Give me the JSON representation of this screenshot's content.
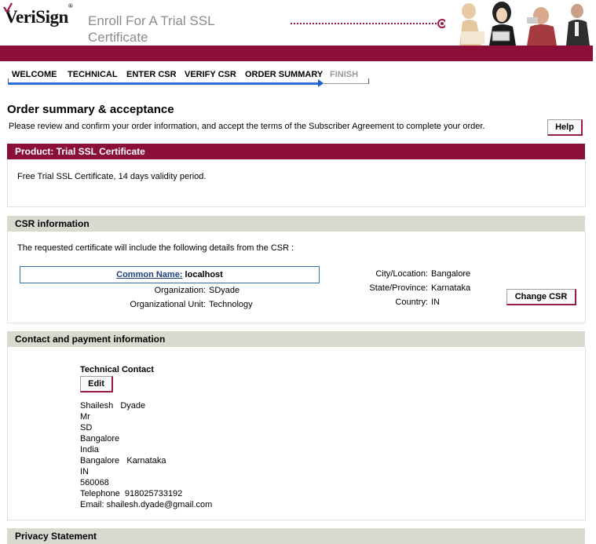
{
  "header": {
    "logo_text": "VeriSign",
    "logo_mark": "®",
    "title_line1": "Enroll For A Trial SSL",
    "title_line2": "Certificate"
  },
  "steps": [
    {
      "label": "WELCOME",
      "state": "done"
    },
    {
      "label": "TECHNICAL",
      "state": "done"
    },
    {
      "label": "ENTER CSR",
      "state": "done"
    },
    {
      "label": "VERIFY CSR",
      "state": "done"
    },
    {
      "label": "ORDER SUMMARY",
      "state": "current"
    },
    {
      "label": "FINISH",
      "state": "todo"
    }
  ],
  "page": {
    "title": "Order summary & acceptance",
    "intro": "Please review and confirm your order information, and accept the terms of the Subscriber Agreement to complete your order.",
    "help_label": "Help"
  },
  "product": {
    "heading": "Product:  Trial SSL Certificate",
    "description": "Free Trial SSL Certificate, 14 days validity period."
  },
  "csr": {
    "heading": "CSR information",
    "intro": "The requested certificate will include the following details from the CSR :",
    "common_name_label": "Common Name:",
    "common_name_value": "localhost",
    "organization_label": "Organization:",
    "organization_value": "SDyade",
    "org_unit_label": "Organizational Unit:",
    "org_unit_value": "Technology",
    "city_label": "City/Location:",
    "city_value": "Bangalore",
    "state_label": "State/Province:",
    "state_value": "Karnataka",
    "country_label": "Country:",
    "country_value": "IN",
    "change_label": "Change CSR"
  },
  "contact": {
    "heading": "Contact and payment information",
    "tech_heading": "Technical Contact",
    "edit_label": "Edit",
    "lines": [
      "Shailesh   Dyade",
      "Mr",
      "SD",
      "Bangalore",
      "India",
      "Bangalore   Karnataka",
      "IN",
      "560068",
      "Telephone  918025733192",
      "Email: shailesh.dyade@gmail.com"
    ]
  },
  "privacy": {
    "heading": "Privacy Statement"
  },
  "colors": {
    "brand": "#8c0f3a",
    "progress": "#2a6fd6",
    "section_grey": "#d9d9d0"
  }
}
